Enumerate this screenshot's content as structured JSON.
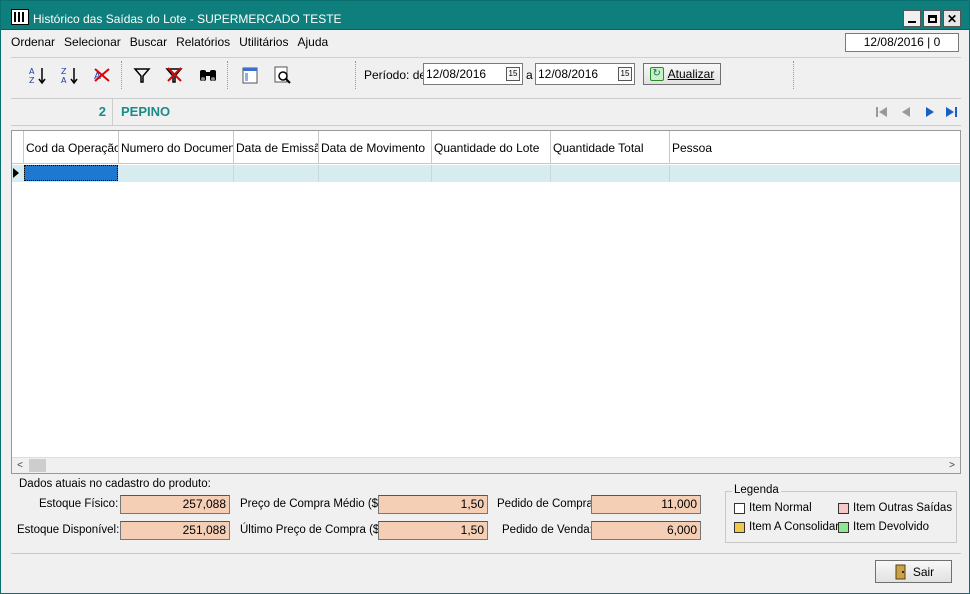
{
  "window": {
    "title": "Histórico das Saídas do Lote - SUPERMERCADO TESTE",
    "app_icon": "app-grid-icon"
  },
  "menu": {
    "items": [
      "Ordenar",
      "Selecionar",
      "Buscar",
      "Relatórios",
      "Utilitários",
      "Ajuda"
    ]
  },
  "header_date": "12/08/2016 | 0",
  "toolbar": {
    "periodo_label": "Período: de",
    "date_from": "12/08/2016",
    "separator_a": "a",
    "date_to": "12/08/2016",
    "calendar_icon_text": "15",
    "refresh_label": "Atualizar"
  },
  "product": {
    "code": "2",
    "name": "PEPINO"
  },
  "grid": {
    "columns": [
      "Cod da Operação",
      "Numero do Documento",
      "Data de Emissão",
      "Data de Movimento",
      "Quantidade do Lote",
      "Quantidade Total",
      "Pessoa"
    ]
  },
  "panel": {
    "title": "Dados atuais no cadastro do produto:",
    "estoque_fisico_label": "Estoque Físico:",
    "estoque_fisico": "257,088",
    "estoque_disponivel_label": "Estoque Disponível:",
    "estoque_disponivel": "251,088",
    "preco_medio_label": "Preço de Compra Médio ($):",
    "preco_medio": "1,50",
    "ultimo_preco_label": "Último Preço de Compra ($):",
    "ultimo_preco": "1,50",
    "pedido_compra_label": "Pedido de Compra:",
    "pedido_compra": "11,000",
    "pedido_venda_label": "Pedido de Venda:",
    "pedido_venda": "6,000"
  },
  "legend": {
    "title": "Legenda",
    "items": [
      {
        "label": "Item Normal",
        "color": "#ffffff"
      },
      {
        "label": "Item Outras Saídas",
        "color": "#f7c8c8"
      },
      {
        "label": "Item A Consolidar",
        "color": "#f0c84a"
      },
      {
        "label": "Item Devolvido",
        "color": "#8fe88f"
      }
    ]
  },
  "footer": {
    "exit_label": "Sair"
  },
  "colors": {
    "titlebar": "#0e7f7c",
    "accent_text": "#1d8a8a",
    "value_bg": "#f5cfb5",
    "row_selected": "#d6ecee"
  }
}
